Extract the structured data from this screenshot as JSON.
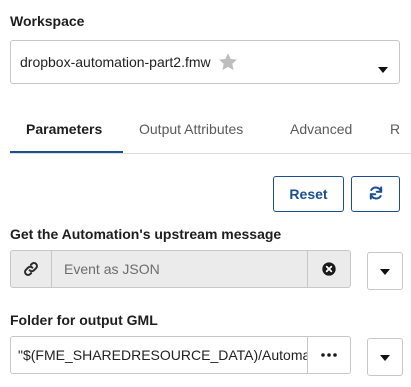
{
  "workspace": {
    "label": "Workspace",
    "selected": "dropbox-automation-part2.fmw",
    "star_icon": "star-icon",
    "caret_icon": "caret-down-icon"
  },
  "tabs": [
    {
      "label": "Parameters",
      "active": true
    },
    {
      "label": "Output Attributes",
      "active": false
    },
    {
      "label": "Advanced",
      "active": false
    },
    {
      "label": "R",
      "active": false
    }
  ],
  "actions": {
    "reset_label": "Reset",
    "refresh_icon": "refresh-icon"
  },
  "upstream": {
    "label": "Get the Automation's upstream message",
    "value": "Event as JSON",
    "link_icon": "link-icon",
    "clear_icon": "clear-circle-icon",
    "menu_icon": "caret-down-icon"
  },
  "output_folder": {
    "label": "Folder for output GML",
    "value": "\"$(FME_SHAREDRESOURCE_DATA)/Automations/",
    "browse_icon": "ellipsis-icon",
    "menu_icon": "caret-down-icon"
  },
  "colors": {
    "accent": "#1b4f91",
    "border": "#c7c7c7",
    "disabled_bg": "#ebebeb"
  }
}
